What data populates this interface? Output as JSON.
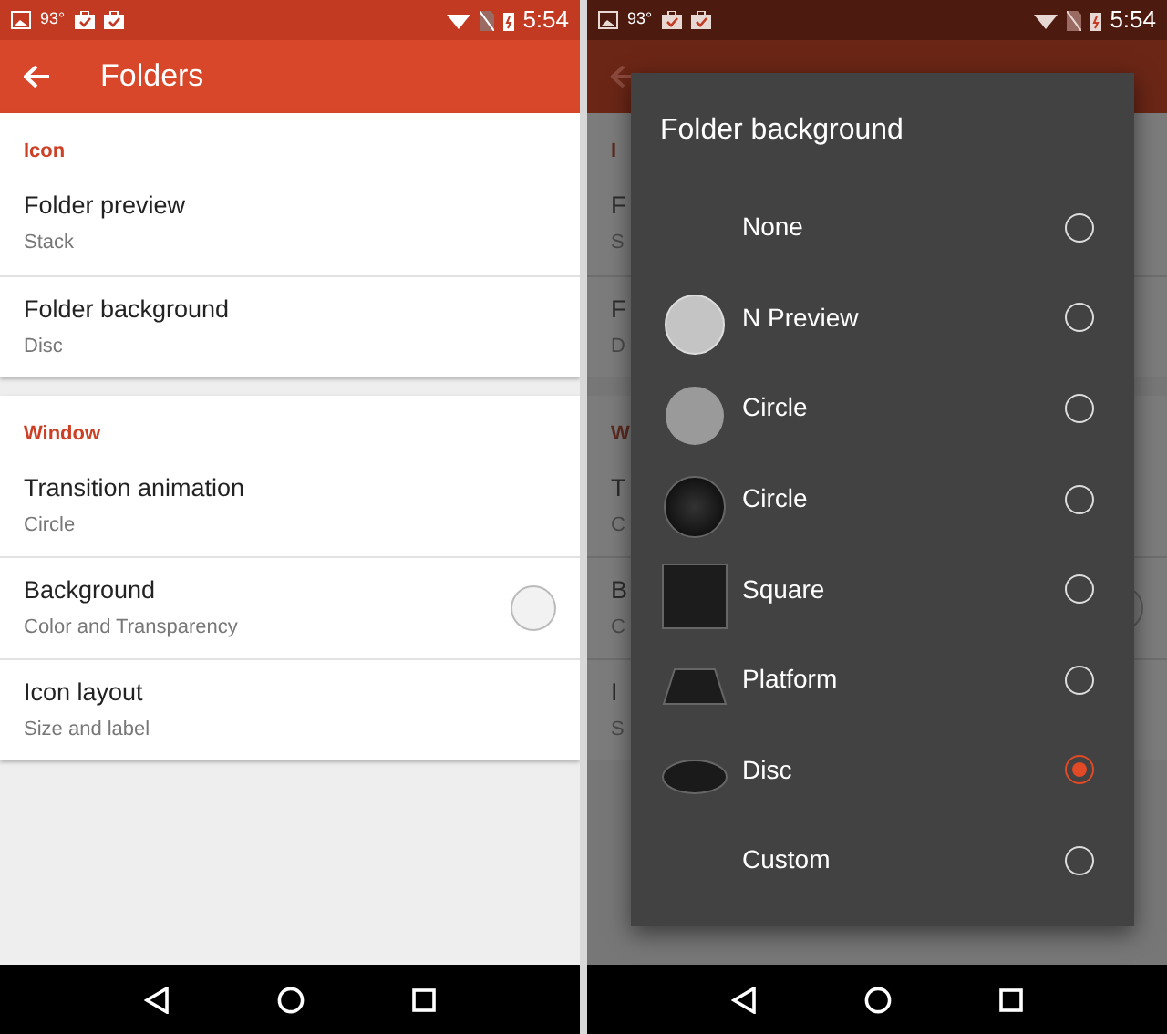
{
  "screens": [
    {
      "dimmed": false,
      "status_bar": {
        "temperature": "93°",
        "time": "5:54"
      },
      "app_bar": {
        "title": "Folders"
      },
      "sections": [
        {
          "header": "Icon",
          "items": [
            {
              "title": "Folder preview",
              "subtitle": "Stack"
            },
            {
              "title": "Folder background",
              "subtitle": "Disc"
            }
          ]
        },
        {
          "header": "Window",
          "items": [
            {
              "title": "Transition animation",
              "subtitle": "Circle"
            },
            {
              "title": "Background",
              "subtitle": "Color and Transparency",
              "kind": "color"
            },
            {
              "title": "Icon layout",
              "subtitle": "Size and label"
            }
          ]
        }
      ]
    },
    {
      "dimmed": true,
      "status_bar": {
        "temperature": "93°",
        "time": "5:54"
      },
      "sections": [
        {
          "header": "I",
          "items": [
            {
              "title": "F",
              "subtitle": "S"
            },
            {
              "title": "F",
              "subtitle": "D"
            }
          ]
        },
        {
          "header": "W",
          "items": [
            {
              "title": "T",
              "subtitle": "C"
            },
            {
              "title": "B",
              "subtitle": "C",
              "kind": "color"
            },
            {
              "title": "I",
              "subtitle": "S"
            }
          ]
        }
      ],
      "dialog": {
        "title": "Folder background",
        "options": [
          {
            "label": "None",
            "kind": "none",
            "selected": false
          },
          {
            "label": "N Preview",
            "kind": "light-circle",
            "selected": false
          },
          {
            "label": "Circle",
            "kind": "grey-circle",
            "selected": false
          },
          {
            "label": "Circle",
            "kind": "dark-circle",
            "selected": false
          },
          {
            "label": "Square",
            "kind": "square",
            "selected": false
          },
          {
            "label": "Platform",
            "kind": "platform",
            "selected": false
          },
          {
            "label": "Disc",
            "kind": "disc",
            "selected": true
          },
          {
            "label": "Custom",
            "kind": "none",
            "selected": false
          }
        ]
      }
    }
  ]
}
